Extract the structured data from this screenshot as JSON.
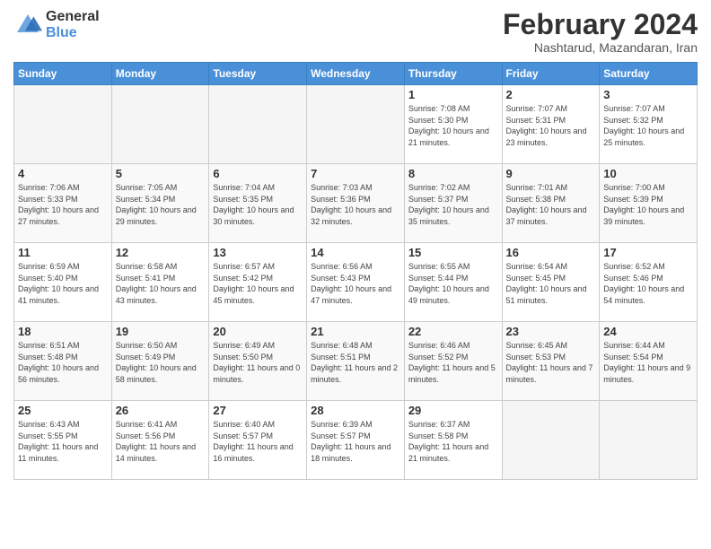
{
  "logo": {
    "general": "General",
    "blue": "Blue"
  },
  "title": "February 2024",
  "subtitle": "Nashtarud, Mazandaran, Iran",
  "days_of_week": [
    "Sunday",
    "Monday",
    "Tuesday",
    "Wednesday",
    "Thursday",
    "Friday",
    "Saturday"
  ],
  "weeks": [
    [
      {
        "num": "",
        "empty": true
      },
      {
        "num": "",
        "empty": true
      },
      {
        "num": "",
        "empty": true
      },
      {
        "num": "",
        "empty": true
      },
      {
        "num": "1",
        "sunrise": "7:08 AM",
        "sunset": "5:30 PM",
        "daylight": "10 hours and 21 minutes."
      },
      {
        "num": "2",
        "sunrise": "7:07 AM",
        "sunset": "5:31 PM",
        "daylight": "10 hours and 23 minutes."
      },
      {
        "num": "3",
        "sunrise": "7:07 AM",
        "sunset": "5:32 PM",
        "daylight": "10 hours and 25 minutes."
      }
    ],
    [
      {
        "num": "4",
        "sunrise": "7:06 AM",
        "sunset": "5:33 PM",
        "daylight": "10 hours and 27 minutes."
      },
      {
        "num": "5",
        "sunrise": "7:05 AM",
        "sunset": "5:34 PM",
        "daylight": "10 hours and 29 minutes."
      },
      {
        "num": "6",
        "sunrise": "7:04 AM",
        "sunset": "5:35 PM",
        "daylight": "10 hours and 30 minutes."
      },
      {
        "num": "7",
        "sunrise": "7:03 AM",
        "sunset": "5:36 PM",
        "daylight": "10 hours and 32 minutes."
      },
      {
        "num": "8",
        "sunrise": "7:02 AM",
        "sunset": "5:37 PM",
        "daylight": "10 hours and 35 minutes."
      },
      {
        "num": "9",
        "sunrise": "7:01 AM",
        "sunset": "5:38 PM",
        "daylight": "10 hours and 37 minutes."
      },
      {
        "num": "10",
        "sunrise": "7:00 AM",
        "sunset": "5:39 PM",
        "daylight": "10 hours and 39 minutes."
      }
    ],
    [
      {
        "num": "11",
        "sunrise": "6:59 AM",
        "sunset": "5:40 PM",
        "daylight": "10 hours and 41 minutes."
      },
      {
        "num": "12",
        "sunrise": "6:58 AM",
        "sunset": "5:41 PM",
        "daylight": "10 hours and 43 minutes."
      },
      {
        "num": "13",
        "sunrise": "6:57 AM",
        "sunset": "5:42 PM",
        "daylight": "10 hours and 45 minutes."
      },
      {
        "num": "14",
        "sunrise": "6:56 AM",
        "sunset": "5:43 PM",
        "daylight": "10 hours and 47 minutes."
      },
      {
        "num": "15",
        "sunrise": "6:55 AM",
        "sunset": "5:44 PM",
        "daylight": "10 hours and 49 minutes."
      },
      {
        "num": "16",
        "sunrise": "6:54 AM",
        "sunset": "5:45 PM",
        "daylight": "10 hours and 51 minutes."
      },
      {
        "num": "17",
        "sunrise": "6:52 AM",
        "sunset": "5:46 PM",
        "daylight": "10 hours and 54 minutes."
      }
    ],
    [
      {
        "num": "18",
        "sunrise": "6:51 AM",
        "sunset": "5:48 PM",
        "daylight": "10 hours and 56 minutes."
      },
      {
        "num": "19",
        "sunrise": "6:50 AM",
        "sunset": "5:49 PM",
        "daylight": "10 hours and 58 minutes."
      },
      {
        "num": "20",
        "sunrise": "6:49 AM",
        "sunset": "5:50 PM",
        "daylight": "11 hours and 0 minutes."
      },
      {
        "num": "21",
        "sunrise": "6:48 AM",
        "sunset": "5:51 PM",
        "daylight": "11 hours and 2 minutes."
      },
      {
        "num": "22",
        "sunrise": "6:46 AM",
        "sunset": "5:52 PM",
        "daylight": "11 hours and 5 minutes."
      },
      {
        "num": "23",
        "sunrise": "6:45 AM",
        "sunset": "5:53 PM",
        "daylight": "11 hours and 7 minutes."
      },
      {
        "num": "24",
        "sunrise": "6:44 AM",
        "sunset": "5:54 PM",
        "daylight": "11 hours and 9 minutes."
      }
    ],
    [
      {
        "num": "25",
        "sunrise": "6:43 AM",
        "sunset": "5:55 PM",
        "daylight": "11 hours and 11 minutes."
      },
      {
        "num": "26",
        "sunrise": "6:41 AM",
        "sunset": "5:56 PM",
        "daylight": "11 hours and 14 minutes."
      },
      {
        "num": "27",
        "sunrise": "6:40 AM",
        "sunset": "5:57 PM",
        "daylight": "11 hours and 16 minutes."
      },
      {
        "num": "28",
        "sunrise": "6:39 AM",
        "sunset": "5:57 PM",
        "daylight": "11 hours and 18 minutes."
      },
      {
        "num": "29",
        "sunrise": "6:37 AM",
        "sunset": "5:58 PM",
        "daylight": "11 hours and 21 minutes."
      },
      {
        "num": "",
        "empty": true
      },
      {
        "num": "",
        "empty": true
      }
    ]
  ],
  "labels": {
    "sunrise": "Sunrise:",
    "sunset": "Sunset:",
    "daylight": "Daylight:"
  }
}
